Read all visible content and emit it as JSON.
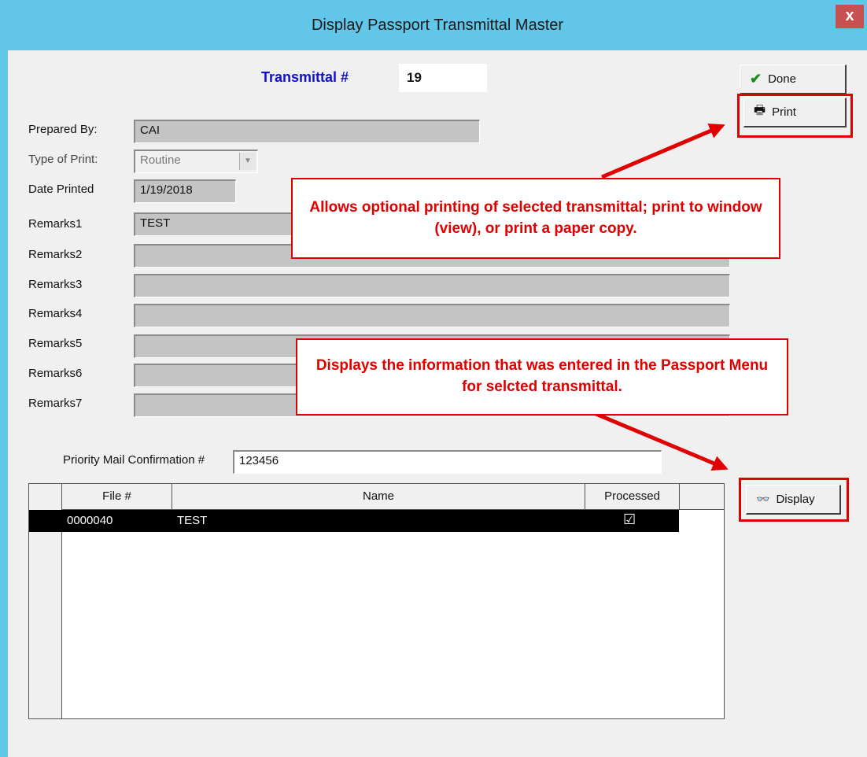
{
  "window": {
    "title": "Display Passport Transmittal Master",
    "close_label": "x"
  },
  "header": {
    "transmittal_label": "Transmittal #",
    "transmittal_value": "19"
  },
  "buttons": {
    "done": "Done",
    "print": "Print",
    "display": "Display"
  },
  "form": {
    "prepared_by_label": "Prepared By:",
    "prepared_by_value": "CAI",
    "type_of_print_label": "Type of Print:",
    "type_of_print_value": "Routine",
    "date_printed_label": "Date Printed",
    "date_printed_value": "1/19/2018",
    "remarks": [
      {
        "label": "Remarks1",
        "value": "TEST"
      },
      {
        "label": "Remarks2",
        "value": ""
      },
      {
        "label": "Remarks3",
        "value": ""
      },
      {
        "label": "Remarks4",
        "value": ""
      },
      {
        "label": "Remarks5",
        "value": ""
      },
      {
        "label": "Remarks6",
        "value": ""
      },
      {
        "label": "Remarks7",
        "value": ""
      }
    ],
    "priority_label": "Priority Mail Confirmation #",
    "priority_value": "123456"
  },
  "grid": {
    "columns": [
      "File #",
      "Name",
      "Processed"
    ],
    "rows": [
      {
        "file": "0000040",
        "name": "TEST",
        "processed": "☑"
      }
    ]
  },
  "callouts": {
    "print_note": "Allows optional printing of selected transmittal; print to window (view), or print a paper copy.",
    "display_note": "Displays the information that was entered in the Passport Menu for selcted transmittal."
  },
  "colors": {
    "title_bar": "#62c6e8",
    "annotation_red": "#e00000",
    "transmittal_label_blue": "#1010d0"
  }
}
